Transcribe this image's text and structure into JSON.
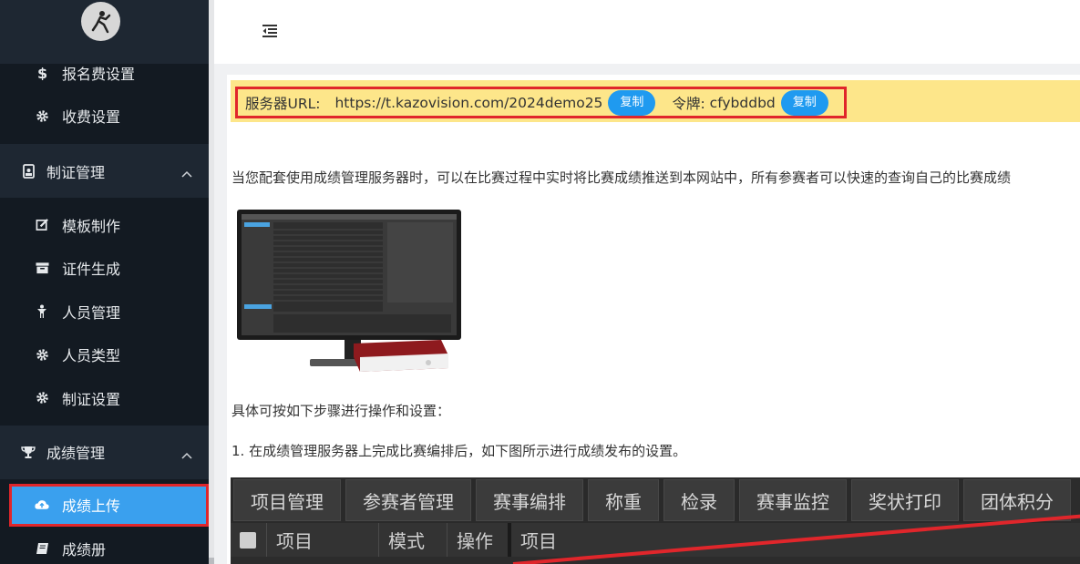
{
  "sidebar": {
    "items_top": [
      {
        "label": "报名费设置",
        "icon": "dollar-icon"
      },
      {
        "label": "收费设置",
        "icon": "gear-icon"
      }
    ],
    "groups": [
      {
        "label": "制证管理",
        "icon": "id-badge-icon",
        "items": [
          {
            "label": "模板制作",
            "icon": "edit-icon"
          },
          {
            "label": "证件生成",
            "icon": "archive-icon"
          },
          {
            "label": "人员管理",
            "icon": "person-icon"
          },
          {
            "label": "人员类型",
            "icon": "gear-icon"
          },
          {
            "label": "制证设置",
            "icon": "gear-icon"
          }
        ]
      },
      {
        "label": "成绩管理",
        "icon": "trophy-icon",
        "items": [
          {
            "label": "成绩上传",
            "icon": "cloud-upload-icon",
            "active": true
          },
          {
            "label": "成绩册",
            "icon": "book-icon"
          }
        ]
      }
    ]
  },
  "alert": {
    "url_label": "服务器URL:",
    "url_value": "https://t.kazovision.com/2024demo25",
    "copy_label": "复制",
    "token_label": "令牌:",
    "token_value": "cfybddbd"
  },
  "content": {
    "intro": "当您配套使用成绩管理服务器时，可以在比赛过程中实时将比赛成绩推送到本网站中，所有参赛者可以快速的查询自己的比赛成绩",
    "steps_intro": "具体可按如下步骤进行操作和设置：",
    "step1": "1. 在成绩管理服务器上完成比赛编排后，如下图所示进行成绩发布的设置。"
  },
  "app_screenshot": {
    "tabs": [
      "项目管理",
      "参赛者管理",
      "赛事编排",
      "称重",
      "检录",
      "赛事监控",
      "奖状打印",
      "团体积分"
    ],
    "columns": [
      "项目",
      "模式",
      "操作",
      "项目"
    ]
  },
  "colors": {
    "sidebar_bg": "#131a22",
    "active_bg": "#3aa0ee",
    "alert_bg": "#fde68a",
    "copy_btn": "#1f9af0",
    "highlight_border": "#e0262b"
  }
}
